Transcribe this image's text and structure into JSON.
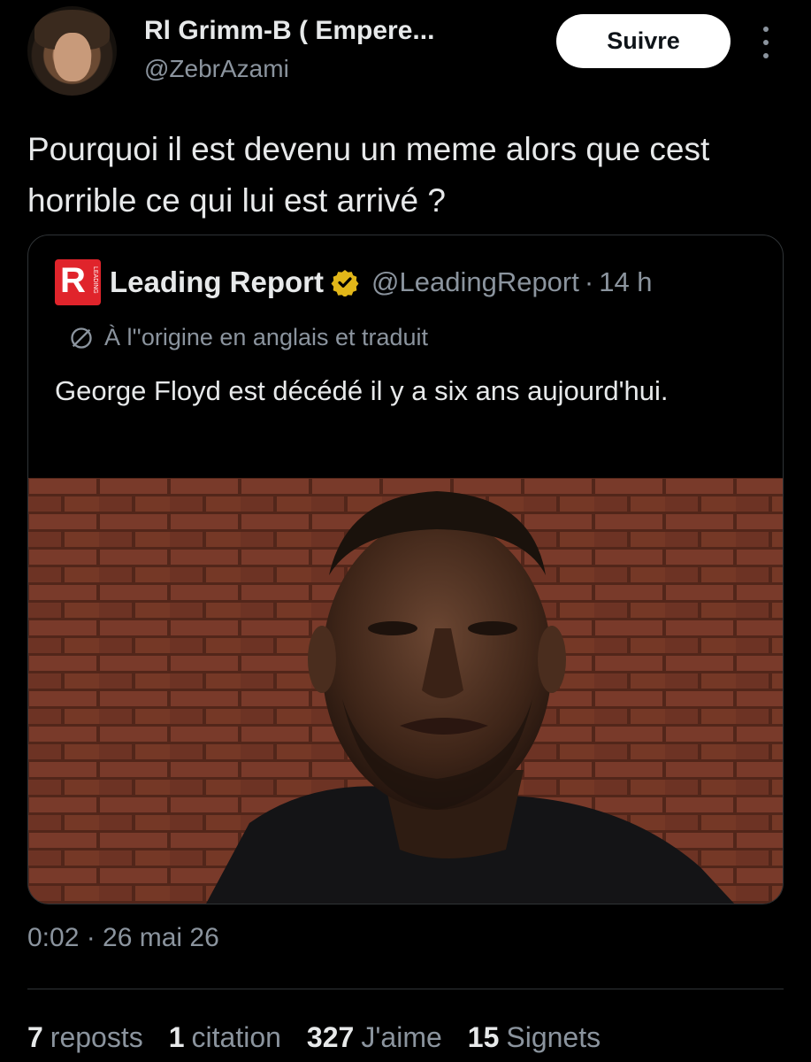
{
  "author": {
    "name": "Rl Grimm-B ( Empere...",
    "handle": "@ZebrAzami"
  },
  "follow_label": "Suivre",
  "tweet_text": "Pourquoi il est devenu un meme alors que cest horrible ce qui lui est arrivé ?",
  "quoted": {
    "logo_letter": "R",
    "logo_side_text": "LEADING",
    "name": "Leading Report",
    "handle": "@LeadingReport",
    "separator": "·",
    "time": "14 h",
    "translation_note": "À l''origine en anglais et traduit",
    "text": "George Floyd est décédé il y a six ans aujourd'hui."
  },
  "timestamp": "0:02 · 26 mai 26",
  "stats": [
    {
      "count": "7",
      "label": "reposts"
    },
    {
      "count": "1",
      "label": "citation"
    },
    {
      "count": "327",
      "label": "J'aime"
    },
    {
      "count": "15",
      "label": "Signets"
    }
  ],
  "colors": {
    "background": "#000000",
    "text_primary": "#e7e9ea",
    "text_secondary": "#8b949e",
    "verified_gold": "#e2b719",
    "brand_red": "#e0242b"
  },
  "icons": {
    "more": "more-vertical-icon",
    "verified": "verified-badge-icon",
    "translate": "globe-icon"
  }
}
